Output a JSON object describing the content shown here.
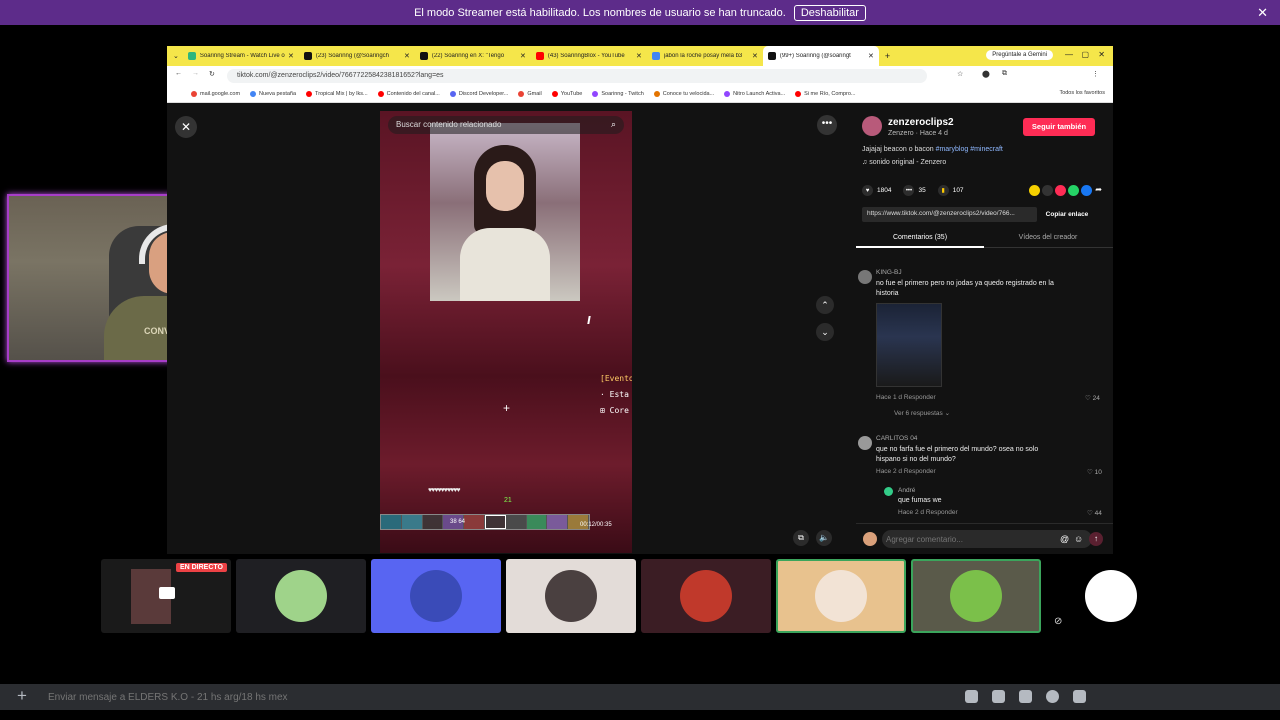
{
  "banner": {
    "text": "El modo Streamer está habilitado. Los nombres de usuario se han truncado.",
    "button": "Deshabilitar"
  },
  "browser": {
    "tabs": [
      {
        "label": "Soarinng Stream - Watch Live o",
        "color": "#2eb67d",
        "active": false
      },
      {
        "label": "(23) Soarinng (@Soaringch",
        "color": "#111111",
        "active": false
      },
      {
        "label": "(22) Soarinng en X: \"Tengo",
        "color": "#111111",
        "active": false
      },
      {
        "label": "(43) SoarinngBlox - YouTube",
        "color": "#ff0000",
        "active": false
      },
      {
        "label": "jabon la roche posay mela b3",
        "color": "#4285f4",
        "active": false
      },
      {
        "label": "(99+) Soarinng (@soaringt",
        "color": "#111111",
        "active": true
      }
    ],
    "gemini": "Pregúntale a Gemini",
    "url": "tiktok.com/@zenzeroclips2/video/7667722584238181652?lang=es",
    "bookmarks": [
      {
        "label": "mail.google.com",
        "color": "#ea4335"
      },
      {
        "label": "Nueva pestaña",
        "color": "#4285f4"
      },
      {
        "label": "Tropical Mix | by lks...",
        "color": "#ff0000"
      },
      {
        "label": "Contenido del canal...",
        "color": "#ff0000"
      },
      {
        "label": "Discord Developer...",
        "color": "#5865f2"
      },
      {
        "label": "Gmail",
        "color": "#ea4335"
      },
      {
        "label": "YouTube",
        "color": "#ff0000"
      },
      {
        "label": "Soarinng - Twitch",
        "color": "#9146ff"
      },
      {
        "label": "Conoce tu velocida...",
        "color": "#e37400"
      },
      {
        "label": "Nitro Launch Activa...",
        "color": "#9146ff"
      },
      {
        "label": "Si me Río, Compro...",
        "color": "#ff0000"
      }
    ],
    "all_bookmarks": "Todos los favoritos"
  },
  "video": {
    "search_placeholder": "Buscar contenido relacionado",
    "mc_lines": [
      "[Evento",
      "· Esta",
      "⊞ Core"
    ],
    "hearts": "♥♥♥♥♥♥♥♥♥♥",
    "level": "21",
    "timer": "00:12/00:35",
    "hotbar_counts": "38   64"
  },
  "panel": {
    "username": "zenzeroclips2",
    "subline": "Zenzero · Hace 4 d",
    "follow": "Seguir también",
    "desc_text": "Jajajaj beacon o bacon ",
    "desc_tags": "#maryblog #minecraft",
    "sound": "♫ sonido original - Zenzero",
    "likes": "1804",
    "comments": "35",
    "saves": "107",
    "link": "https://www.tiktok.com/@zenzeroclips2/video/766...",
    "copy": "Copiar enlace",
    "tab_comments": "Comentarios (35)",
    "tab_videos": "Vídeos del creador",
    "comment_list": [
      {
        "user": "KING-BJ",
        "text1": "no fue el primero pero no jodas ya quedo registrado en la",
        "text2": "historia",
        "meta": "Hace 1 d   Responder",
        "likes": "♡ 24"
      },
      {
        "user": "CARLITOS 04",
        "text1": "que no farfa fue el primero del mundo? osea no solo",
        "text2": "hispano si no del mundo?",
        "meta": "Hace 2 d   Responder",
        "likes": "♡ 10"
      },
      {
        "user": "André",
        "text1": "que fumas we",
        "text2": "",
        "meta": "Hace 2 d   Responder",
        "likes": "♡ 44"
      }
    ],
    "view_replies": "Ver 6 respuestas ⌄",
    "add_comment_placeholder": "Agregar comentario..."
  },
  "facecam": {
    "shirt_text": "CONVERSE"
  },
  "call": {
    "live_badge": "EN DIRECTO",
    "tiles": [
      {
        "bg": "#1f1f23",
        "ava": "#9fd38a"
      },
      {
        "bg": "#5865f2",
        "ava": "#3a4bb8"
      },
      {
        "bg": "#e3dcd8",
        "ava": "#4a4040"
      },
      {
        "bg": "#3b1d24",
        "ava": "#c0392b"
      },
      {
        "bg": "#e8c28e",
        "ava": "#f2e3d5"
      },
      {
        "bg": "#5a5a4a",
        "ava": "#7bc04a"
      },
      {
        "bg": "#000000",
        "ava": "#ffffff"
      }
    ]
  },
  "message_bar": {
    "placeholder": "Enviar mensaje a ELDERS K.O - 21 hs arg/18 hs mex"
  }
}
